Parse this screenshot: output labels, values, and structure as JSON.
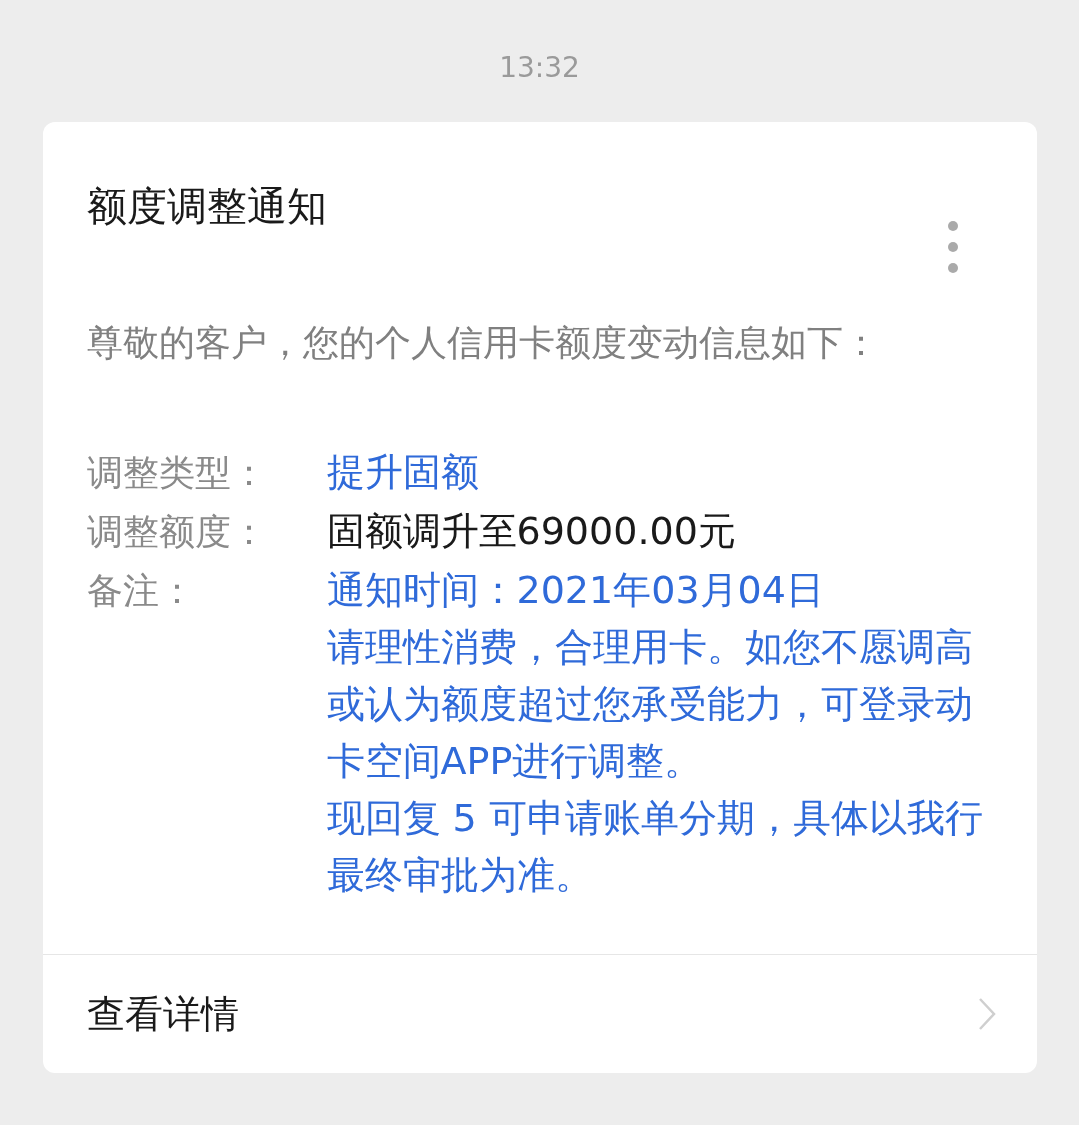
{
  "time": "13:32",
  "card": {
    "title": "额度调整通知",
    "intro": "尊敬的客户，您的个人信用卡额度变动信息如下：",
    "fields": [
      {
        "label": "调整类型：",
        "color": "#2f6ad9",
        "lines": [
          "提升固额"
        ]
      },
      {
        "label": "调整额度：",
        "color": "#1a1a1a",
        "lines": [
          "固额调升至69000.00元"
        ]
      },
      {
        "label": "备注：",
        "color": "#2f6ad9",
        "lines": [
          "通知时间：2021年03月04日",
          "请理性消费，合理用卡。如您不愿调高或认为额度超过您承受能力，可登录动卡空间APP进行调整。",
          "现回复 5 可申请账单分期，具体以我行最终审批为准。"
        ]
      }
    ],
    "footer": "查看详情"
  }
}
